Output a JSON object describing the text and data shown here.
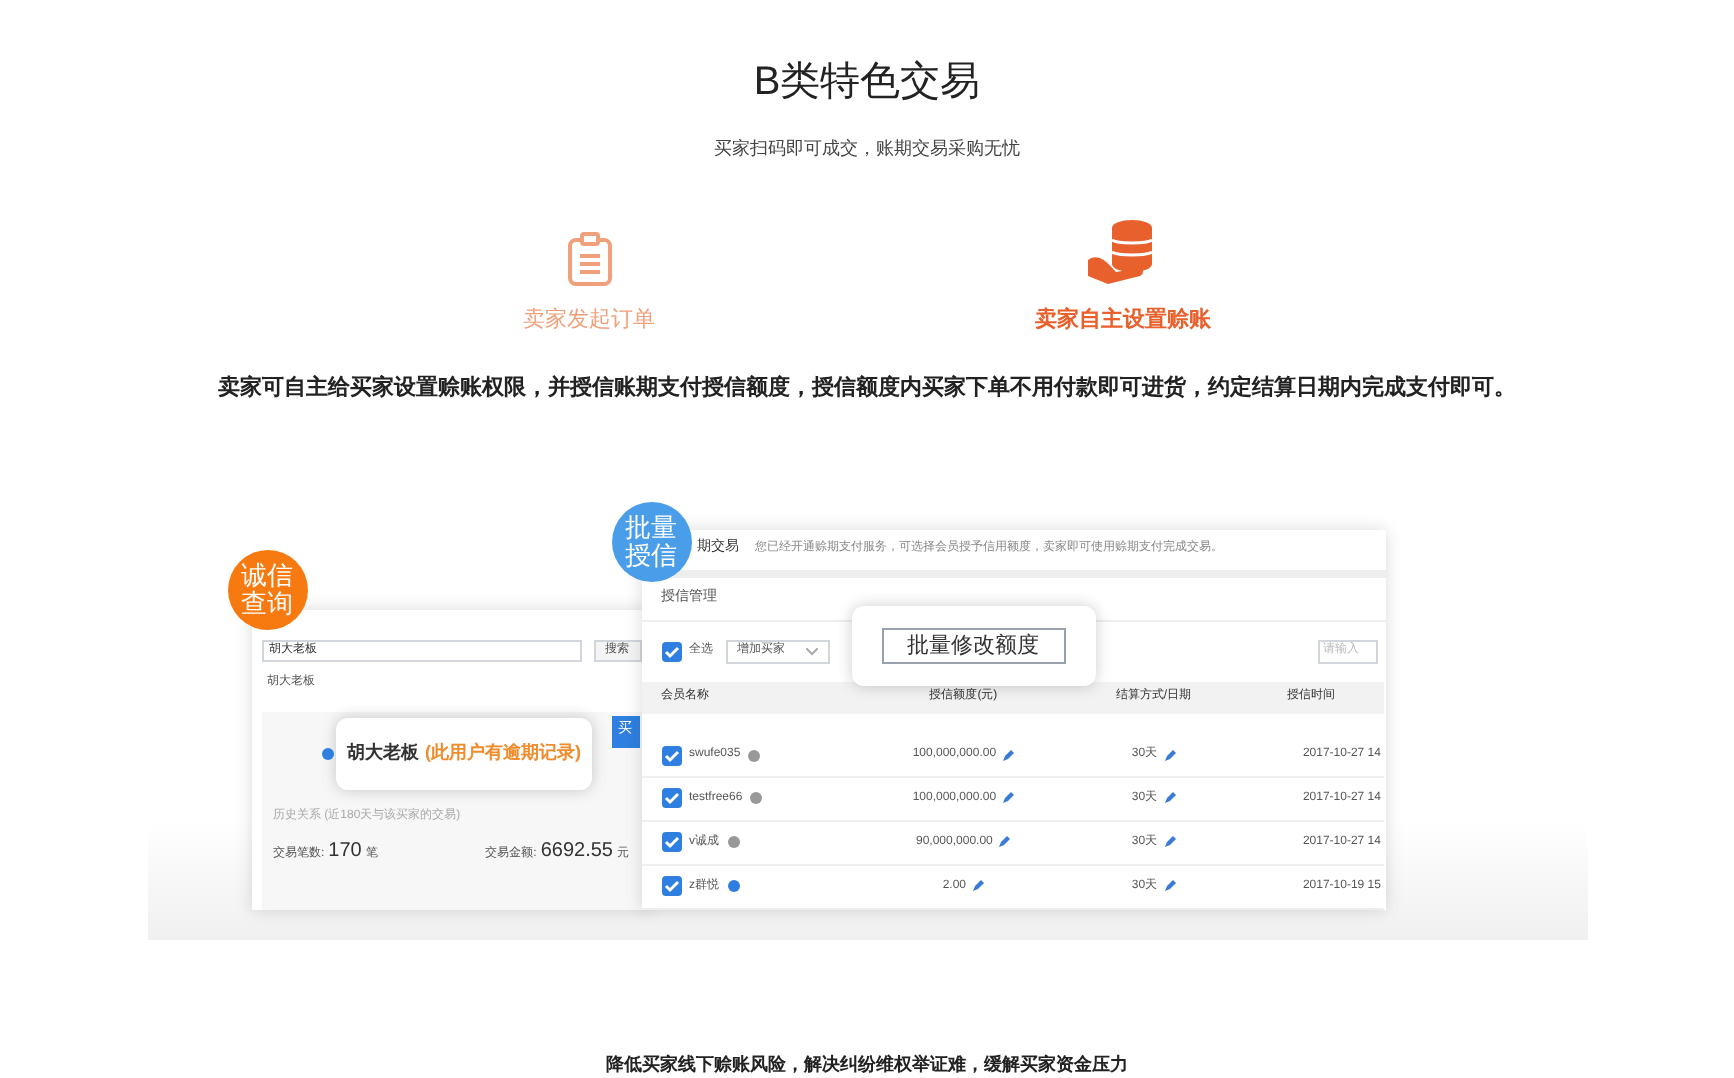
{
  "title": "B类特色交易",
  "subtitle": "买家扫码即可成交，账期交易采购无忧",
  "tabs": [
    {
      "label": "卖家发起订单",
      "selected": false,
      "kind": "clipboard"
    },
    {
      "label": "卖家自主设置赊账",
      "selected": true,
      "kind": "coins"
    }
  ],
  "description": "卖家可自主给买家设置赊账权限，并授信账期支付授信额度，授信额度内买家下单不用付款即可进货，约定结算日期内完成支付即可。",
  "credit_check": {
    "badge": "诚信查询",
    "search_value": "胡大老板",
    "search_button": "搜索",
    "suggestion": "胡大老板",
    "popup_name": "胡大老板",
    "popup_warning": "(此用户有逾期记录)",
    "history_label": "历史关系 (近180天与该买家的交易)",
    "count_label": "交易笔数:",
    "count": "170",
    "count_unit": "笔",
    "amount_label": "交易金额:",
    "amount": "6692.55",
    "amount_unit": "元",
    "side_tab": "买"
  },
  "batch_credit": {
    "badge": "批量授信",
    "header": "期交易",
    "notice": "您已经开通赊期支付服务，可选择会员授予信用额度，卖家即可使用赊期支付完成交易。",
    "section": "授信管理",
    "select_all": {
      "label": "全选",
      "checked": true
    },
    "dropdown": "增加买家",
    "popup_button": "批量修改额度",
    "search_placeholder": "请输入",
    "columns": [
      "会员名称",
      "授信额度(元)",
      "结算方式/日期",
      "授信时间"
    ],
    "rows": [
      {
        "name": "swufe035",
        "checked": true,
        "verified": false,
        "credit": "100,000,000.00",
        "term": "30天",
        "time": "2017-10-27 14"
      },
      {
        "name": "testfree66",
        "checked": true,
        "verified": false,
        "credit": "100,000,000.00",
        "term": "30天",
        "time": "2017-10-27 14"
      },
      {
        "name": "v诚成",
        "checked": true,
        "verified": false,
        "credit": "90,000,000.00",
        "term": "30天",
        "time": "2017-10-27 14"
      },
      {
        "name": "z群悦",
        "checked": true,
        "verified": true,
        "credit": "2.00",
        "term": "30天",
        "time": "2017-10-19 15"
      }
    ]
  },
  "footer": "降低买家线下赊账风险，解决纠纷维权举证难，缓解买家资金压力"
}
